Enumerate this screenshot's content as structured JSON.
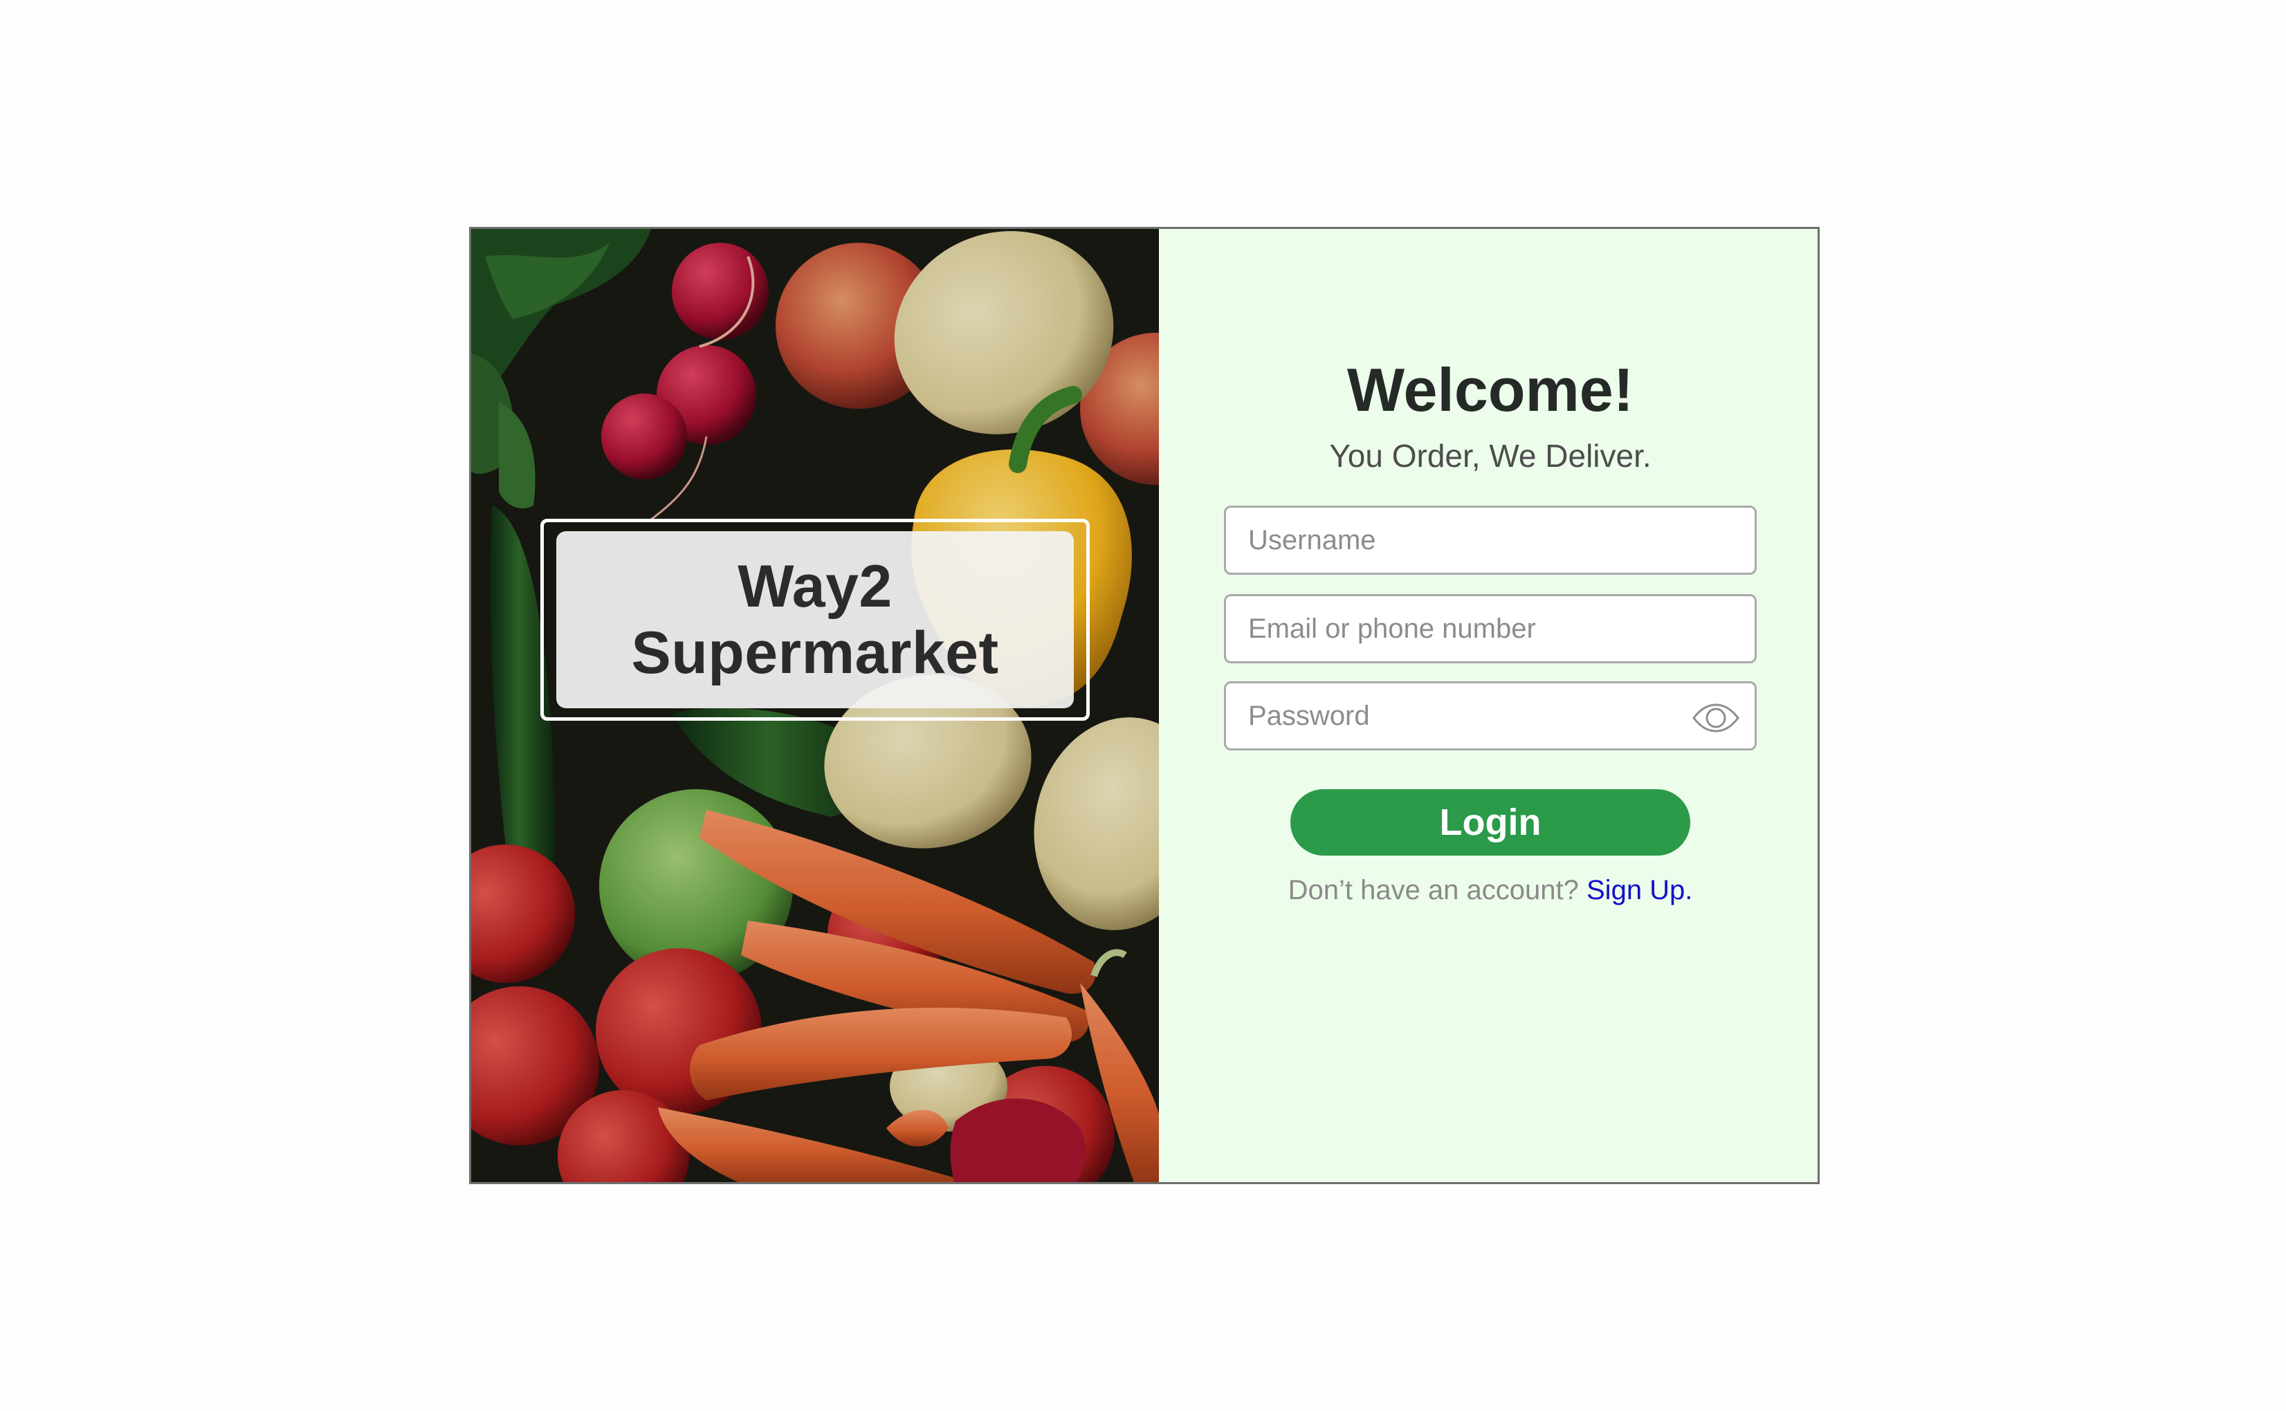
{
  "brand": {
    "line1": "Way2",
    "line2": "Supermarket"
  },
  "photo": {
    "subject": "vegetables-photo"
  },
  "form": {
    "title": "Welcome!",
    "tagline": "You Order, We Deliver.",
    "username_placeholder": "Username",
    "username_value": "",
    "contact_placeholder": "Email or phone number",
    "contact_value": "",
    "password_placeholder": "Password",
    "password_value": "",
    "password_toggle_icon": "eye-icon",
    "login_label": "Login",
    "signup_prompt": "Don’t have an account?",
    "signup_link": "Sign Up."
  },
  "colors": {
    "panel_background": "#edfdeb",
    "login_button": "#2b9a49",
    "signup_link": "#1111cc",
    "card_border": "#6f6f6f"
  }
}
